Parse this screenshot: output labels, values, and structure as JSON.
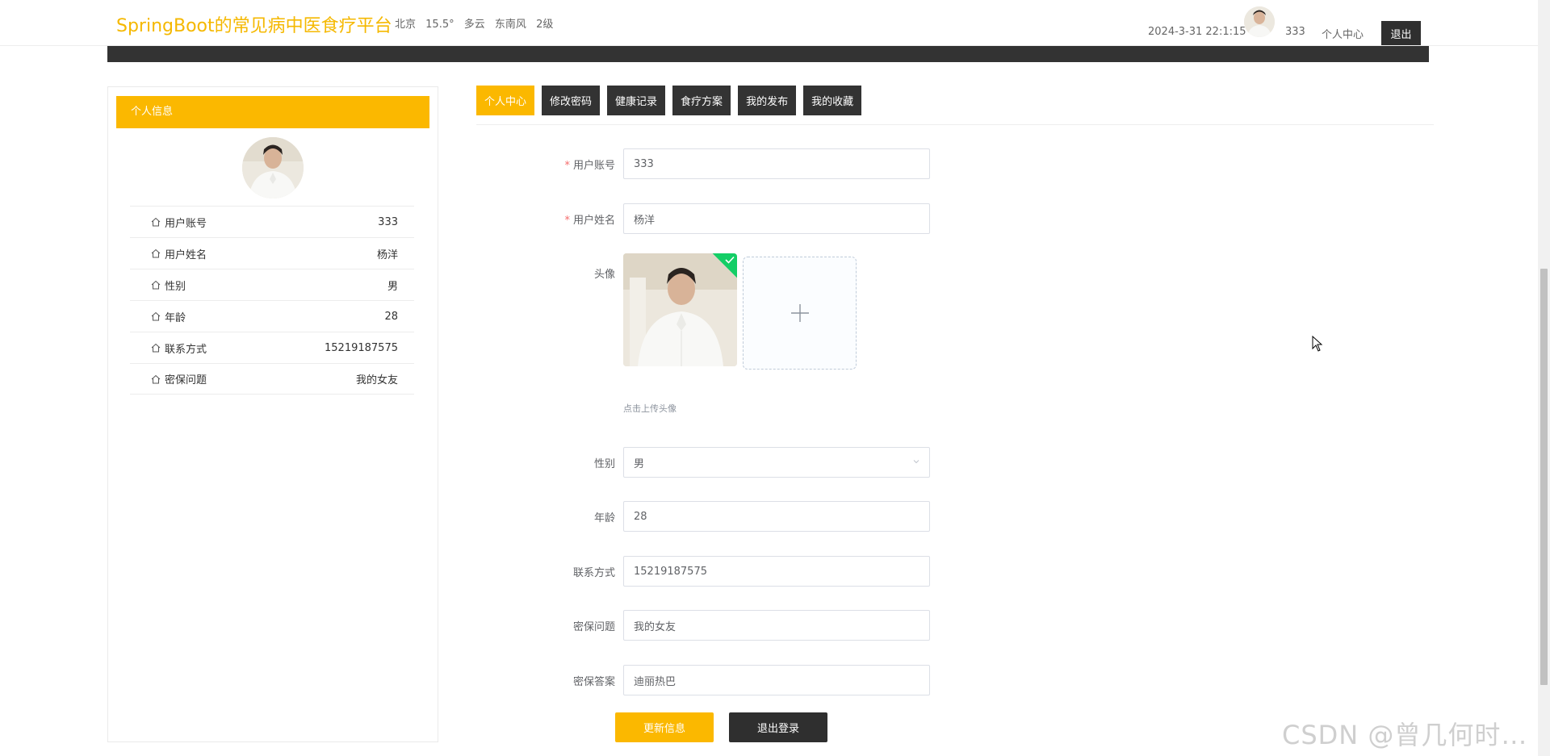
{
  "header": {
    "site_title": "SpringBoot的常见病中医食疗平台",
    "weather": {
      "city": "北京",
      "temp": "15.5°",
      "condition": "多云",
      "wind": "东南风",
      "level": "2级"
    },
    "datetime": "2024-3-31 22:1:15",
    "username": "333",
    "personal_center": "个人中心",
    "logout": "退出"
  },
  "sidebar": {
    "title": "个人信息",
    "rows": [
      {
        "label": "用户账号",
        "value": "333"
      },
      {
        "label": "用户姓名",
        "value": "杨洋"
      },
      {
        "label": "性别",
        "value": "男"
      },
      {
        "label": "年龄",
        "value": "28"
      },
      {
        "label": "联系方式",
        "value": "15219187575"
      },
      {
        "label": "密保问题",
        "value": "我的女友"
      }
    ]
  },
  "tabs": [
    "个人中心",
    "修改密码",
    "健康记录",
    "食疗方案",
    "我的发布",
    "我的收藏"
  ],
  "form": {
    "account_label": "用户账号",
    "account_value": "333",
    "name_label": "用户姓名",
    "name_value": "杨洋",
    "avatar_label": "头像",
    "upload_hint": "点击上传头像",
    "gender_label": "性别",
    "gender_value": "男",
    "age_label": "年龄",
    "age_value": "28",
    "phone_label": "联系方式",
    "phone_value": "15219187575",
    "question_label": "密保问题",
    "question_value": "我的女友",
    "answer_label": "密保答案",
    "answer_value": "迪丽热巴"
  },
  "buttons": {
    "update": "更新信息",
    "logout": "退出登录"
  },
  "watermark": "CSDN @曾几何时…",
  "colors": {
    "accent": "#fbb800",
    "dark": "#333333",
    "success": "#13ce66"
  }
}
